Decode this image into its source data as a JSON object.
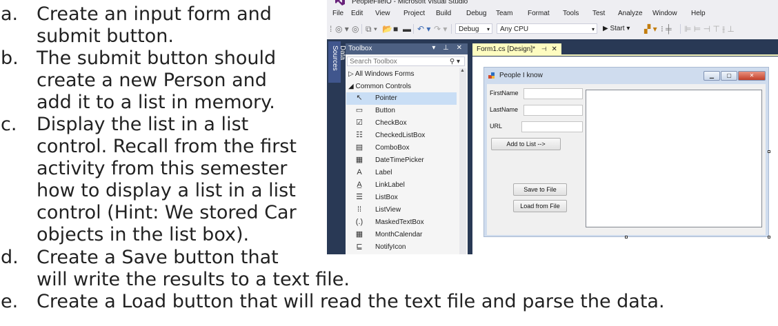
{
  "tasks": [
    {
      "letter": "a.",
      "lines": [
        "Create an input form and",
        "submit button."
      ]
    },
    {
      "letter": "b.",
      "lines": [
        "The submit button should",
        "create a new Person and",
        "add it to a list in memory."
      ]
    },
    {
      "letter": "c.",
      "lines": [
        "Display the list in a list",
        "control. Recall from the first",
        "activity from this semester",
        "how to display a list in a list",
        "control (Hint: We stored Car",
        "objects in the list box)."
      ]
    },
    {
      "letter": "d.",
      "lines": [
        "Create a Save button that",
        "will write the results to a text file."
      ]
    },
    {
      "letter": "e.",
      "lines": [
        "Create a Load button that will read the text file and parse the data."
      ]
    }
  ],
  "vs": {
    "title": "PeopleFileIO - Microsoft Visual Studio",
    "menu": [
      "File",
      "Edit",
      "View",
      "Project",
      "Build",
      "Debug",
      "Team",
      "Format",
      "Tools",
      "Test",
      "Analyze",
      "Window",
      "Help"
    ],
    "toolbar": {
      "config": "Debug",
      "platform": "Any CPU",
      "start": "▶ Start ▾"
    },
    "side_tab": "Data Sources",
    "toolbox": {
      "title": "Toolbox",
      "controls": "▾ ⊥ ✕",
      "search_placeholder": "Search Toolbox",
      "groups": [
        "▷ All Windows Forms",
        "◢ Common Controls"
      ],
      "items": [
        {
          "label": "Pointer",
          "icon": "pointer-icon",
          "glyph": "↖"
        },
        {
          "label": "Button",
          "icon": "button-icon",
          "glyph": "▭"
        },
        {
          "label": "CheckBox",
          "icon": "checkbox-icon",
          "glyph": "☑"
        },
        {
          "label": "CheckedListBox",
          "icon": "checkedlistbox-icon",
          "glyph": "☷"
        },
        {
          "label": "ComboBox",
          "icon": "combobox-icon",
          "glyph": "▤"
        },
        {
          "label": "DateTimePicker",
          "icon": "datetimepicker-icon",
          "glyph": "▦"
        },
        {
          "label": "Label",
          "icon": "label-icon",
          "glyph": "A"
        },
        {
          "label": "LinkLabel",
          "icon": "linklabel-icon",
          "glyph": "A̲"
        },
        {
          "label": "ListBox",
          "icon": "listbox-icon",
          "glyph": "☰"
        },
        {
          "label": "ListView",
          "icon": "listview-icon",
          "glyph": "⁞⁞"
        },
        {
          "label": "MaskedTextBox",
          "icon": "maskedtextbox-icon",
          "glyph": "(.)"
        },
        {
          "label": "MonthCalendar",
          "icon": "monthcalendar-icon",
          "glyph": "▦"
        },
        {
          "label": "NotifyIcon",
          "icon": "notifyicon-icon",
          "glyph": "⊑"
        }
      ]
    },
    "doc_tab": {
      "label": "Form1.cs [Design]*",
      "pin": "⊣",
      "close": "✕"
    },
    "form": {
      "title": "People I know",
      "fields": [
        {
          "label": "FirstName"
        },
        {
          "label": "LastName"
        },
        {
          "label": "URL"
        }
      ],
      "add_button": "Add to List -->",
      "save_button": "Save to File",
      "load_button": "Load from File",
      "window_buttons": {
        "minimize": "▁",
        "maximize": "▢",
        "close": "✕"
      }
    }
  }
}
